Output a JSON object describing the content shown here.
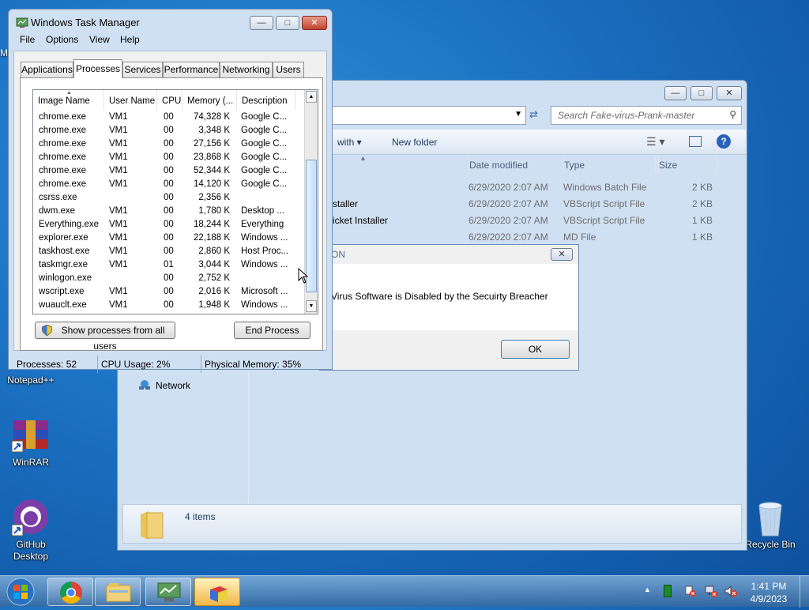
{
  "desktop": {
    "icons": [
      {
        "label": "Notepad++"
      },
      {
        "label": "WinRAR"
      },
      {
        "label": "GitHub Desktop"
      },
      {
        "label": "Recycle Bin"
      }
    ],
    "left_edge_label": "M"
  },
  "explorer": {
    "search_placeholder": "Search Fake-virus-Prank-master",
    "cmd": {
      "open_with": "with",
      "new_folder": "New folder"
    },
    "columns": {
      "date": "Date modified",
      "type": "Type",
      "size": "Size"
    },
    "files": [
      {
        "name": "",
        "date": "6/29/2020 2:07 AM",
        "type": "Windows Batch File",
        "size": "2 KB"
      },
      {
        "name": "staller",
        "date": "6/29/2020 2:07 AM",
        "type": "VBScript Script File",
        "size": "2 KB"
      },
      {
        "name": "ricket Installer",
        "date": "6/29/2020 2:07 AM",
        "type": "VBScript Script File",
        "size": "1 KB"
      },
      {
        "name": "",
        "date": "6/29/2020 2:07 AM",
        "type": "MD File",
        "size": "1 KB"
      }
    ],
    "nav_network": "Network",
    "status_items": "4 items"
  },
  "dialog": {
    "title": "ON",
    "message": "Virus Software is Disabled by the Secuirty Breacher",
    "ok_label": "OK"
  },
  "taskmgr": {
    "title": "Windows Task Manager",
    "menu": [
      "File",
      "Options",
      "View",
      "Help"
    ],
    "tabs": [
      "Applications",
      "Processes",
      "Services",
      "Performance",
      "Networking",
      "Users"
    ],
    "columns": [
      "Image Name",
      "User Name",
      "CPU",
      "Memory (...",
      "Description"
    ],
    "processes": [
      {
        "name": "chrome.exe",
        "user": "VM1",
        "cpu": "00",
        "mem": "74,328 K",
        "desc": "Google C..."
      },
      {
        "name": "chrome.exe",
        "user": "VM1",
        "cpu": "00",
        "mem": "3,348 K",
        "desc": "Google C..."
      },
      {
        "name": "chrome.exe",
        "user": "VM1",
        "cpu": "00",
        "mem": "27,156 K",
        "desc": "Google C..."
      },
      {
        "name": "chrome.exe",
        "user": "VM1",
        "cpu": "00",
        "mem": "23,868 K",
        "desc": "Google C..."
      },
      {
        "name": "chrome.exe",
        "user": "VM1",
        "cpu": "00",
        "mem": "52,344 K",
        "desc": "Google C..."
      },
      {
        "name": "chrome.exe",
        "user": "VM1",
        "cpu": "00",
        "mem": "14,120 K",
        "desc": "Google C..."
      },
      {
        "name": "csrss.exe",
        "user": "",
        "cpu": "00",
        "mem": "2,356 K",
        "desc": ""
      },
      {
        "name": "dwm.exe",
        "user": "VM1",
        "cpu": "00",
        "mem": "1,780 K",
        "desc": "Desktop ..."
      },
      {
        "name": "Everything.exe",
        "user": "VM1",
        "cpu": "00",
        "mem": "18,244 K",
        "desc": "Everything"
      },
      {
        "name": "explorer.exe",
        "user": "VM1",
        "cpu": "00",
        "mem": "22,188 K",
        "desc": "Windows ..."
      },
      {
        "name": "taskhost.exe",
        "user": "VM1",
        "cpu": "00",
        "mem": "2,860 K",
        "desc": "Host Proc..."
      },
      {
        "name": "taskmgr.exe",
        "user": "VM1",
        "cpu": "01",
        "mem": "3,044 K",
        "desc": "Windows ..."
      },
      {
        "name": "winlogon.exe",
        "user": "",
        "cpu": "00",
        "mem": "2,752 K",
        "desc": ""
      },
      {
        "name": "wscript.exe",
        "user": "VM1",
        "cpu": "00",
        "mem": "2,016 K",
        "desc": "Microsoft ..."
      },
      {
        "name": "wuauclt.exe",
        "user": "VM1",
        "cpu": "00",
        "mem": "1,948 K",
        "desc": "Windows ..."
      }
    ],
    "show_all_label": "Show processes from all users",
    "end_process_label": "End Process",
    "status": {
      "processes": "Processes: 52",
      "cpu": "CPU Usage: 2%",
      "memory": "Physical Memory: 35%"
    }
  },
  "taskbar": {
    "time": "1:41 PM",
    "date": "4/9/2023"
  }
}
